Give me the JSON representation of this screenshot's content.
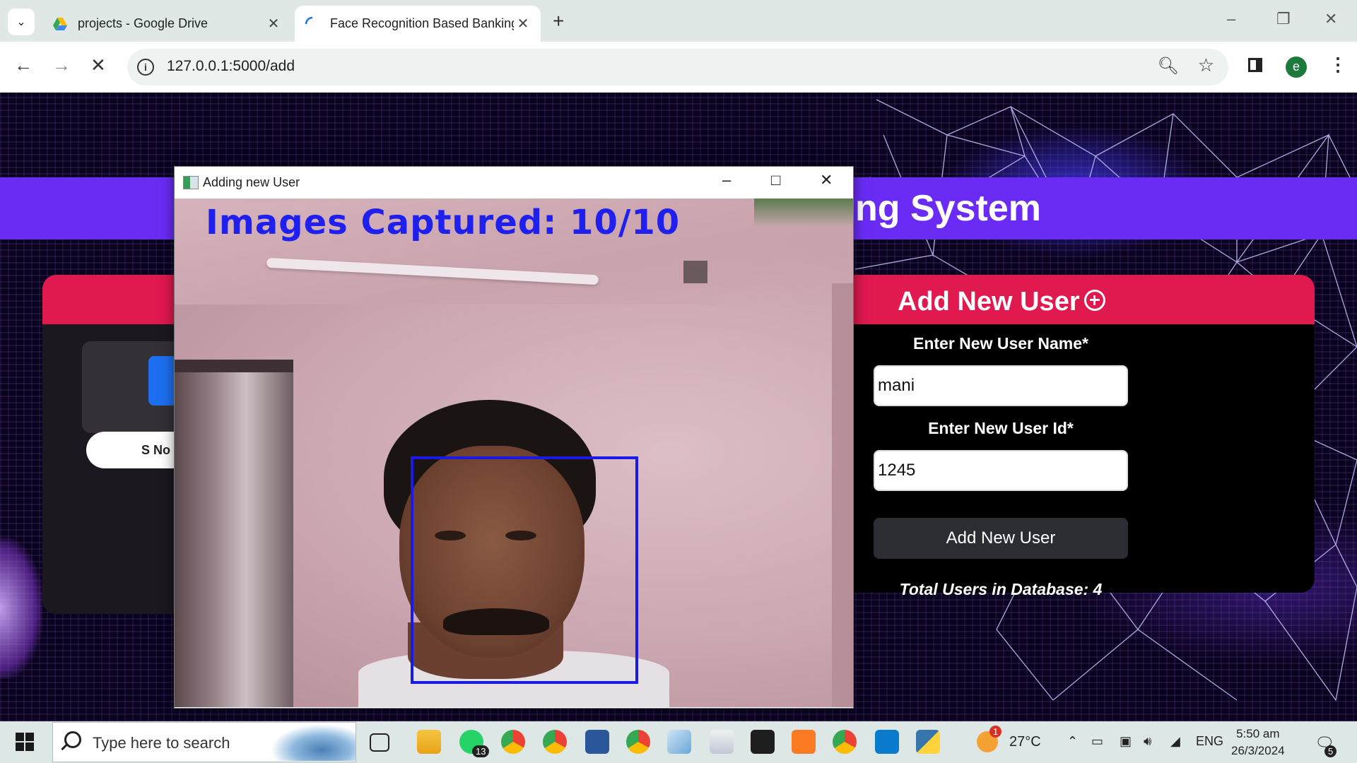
{
  "browser": {
    "tabs": [
      {
        "title": "projects - Google Drive",
        "active": false,
        "icon": "google-drive-icon"
      },
      {
        "title": "Face Recognition Based Banking",
        "active": true,
        "icon": "loading-spinner-icon"
      }
    ],
    "url": "127.0.0.1:5000/add",
    "profile_initial": "e"
  },
  "page": {
    "banner_title_visible": "ng System",
    "left_panel": {
      "table_header_fragment": "S No"
    },
    "form": {
      "title": "Add New User",
      "name_label": "Enter New User Name*",
      "name_value": "mani",
      "id_label": "Enter New User Id*",
      "id_value": "1245",
      "submit_label": "Add New User",
      "total_users_text": "Total Users in Database: 4"
    },
    "colors": {
      "banner": "#6a2cf5",
      "card_header": "#e0194f",
      "button": "#2b2d33"
    }
  },
  "capture_window": {
    "title": "Adding new User",
    "overlay_text": "Images Captured: 10/10",
    "overlay_color": "#2020ee",
    "face_box_color": "#1a1ae6"
  },
  "taskbar": {
    "search_placeholder": "Type here to search",
    "whatsapp_badge": "13",
    "weather_badge": "1",
    "temperature": "27°C",
    "language": "ENG",
    "time": "5:50 am",
    "date": "26/3/2024",
    "notification_count": "5"
  }
}
